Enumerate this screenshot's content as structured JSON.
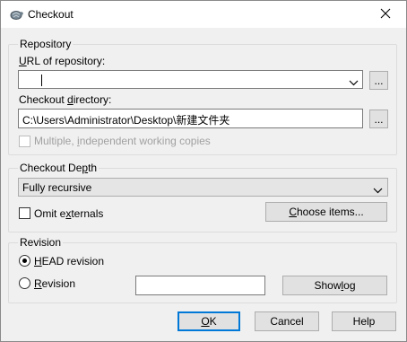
{
  "window": {
    "title": "Checkout"
  },
  "repository": {
    "group_label": "Repository",
    "url_label_u": "U",
    "url_label_rest": "RL of repository:",
    "url_value": "",
    "url_browse": "...",
    "dir_label_pre": "Checkout ",
    "dir_label_u": "d",
    "dir_label_rest": "irectory:",
    "dir_value": "C:\\Users\\Administrator\\Desktop\\新建文件夹",
    "dir_browse": "...",
    "multiple_label_pre": "Multiple, ",
    "multiple_label_u": "i",
    "multiple_label_rest": "ndependent working copies"
  },
  "depth": {
    "group_label_pre": "Checkout De",
    "group_label_u": "p",
    "group_label_rest": "th",
    "selected": "Fully recursive",
    "omit_pre": "Omit e",
    "omit_u": "x",
    "omit_rest": "ternals",
    "choose_pre": "",
    "choose_u": "C",
    "choose_rest": "hoose items..."
  },
  "revision": {
    "group_label": "Revision",
    "head_u": "H",
    "head_rest": "EAD revision",
    "rev_u": "R",
    "rev_rest": "evision",
    "rev_value": "",
    "showlog_pre": "Show ",
    "showlog_u": "l",
    "showlog_rest": "og"
  },
  "footer": {
    "ok_u": "O",
    "ok_rest": "K",
    "cancel": "Cancel",
    "help": "Help"
  }
}
